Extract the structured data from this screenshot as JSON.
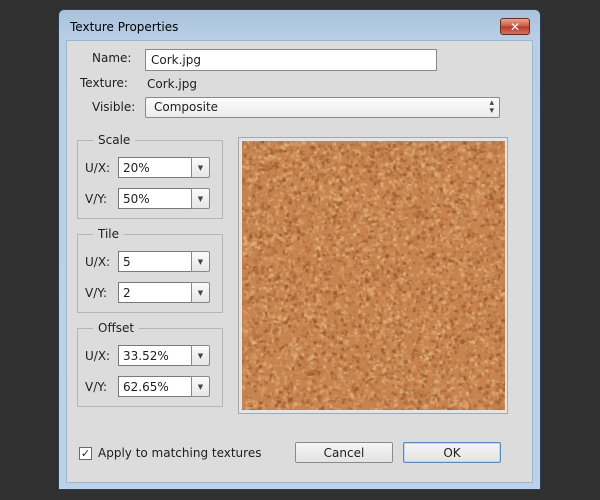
{
  "window": {
    "title": "Texture Properties",
    "close_icon": "close-icon"
  },
  "fields": {
    "name_label": "Name:",
    "name_value": "Cork.jpg",
    "texture_label": "Texture:",
    "texture_value": "Cork.jpg",
    "visible_label": "Visible:",
    "visible_value": "Composite"
  },
  "groups": {
    "scale": {
      "title": "Scale",
      "ux_label": "U/X:",
      "ux_value": "20%",
      "vy_label": "V/Y:",
      "vy_value": "50%"
    },
    "tile": {
      "title": "Tile",
      "ux_label": "U/X:",
      "ux_value": "5",
      "vy_label": "V/Y:",
      "vy_value": "2"
    },
    "offset": {
      "title": "Offset",
      "ux_label": "U/X:",
      "ux_value": "33.52%",
      "vy_label": "V/Y:",
      "vy_value": "62.65%"
    }
  },
  "preview": {
    "texture": "cork",
    "colors": [
      "#c88450",
      "#b06e3c",
      "#d9a06a",
      "#9a5a2e",
      "#e0b07c"
    ]
  },
  "footer": {
    "apply_checked": true,
    "apply_label": "Apply to matching textures",
    "cancel_label": "Cancel",
    "ok_label": "OK"
  }
}
